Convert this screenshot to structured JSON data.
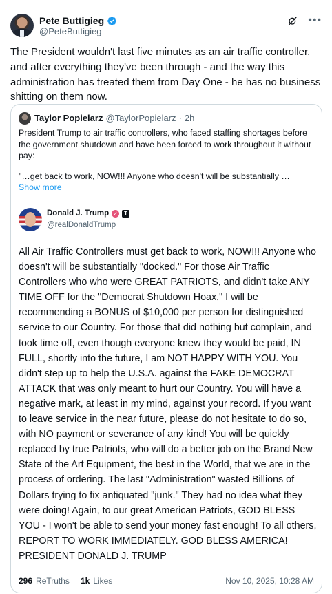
{
  "author": {
    "name": "Pete Buttigieg",
    "handle": "@PeteButtigieg"
  },
  "tweet_text": "The President wouldn't last five minutes as an air traffic controller, and after everything they've been through - and the way this administration has treated them from Day One - he has no business shitting on them now.",
  "icons": {
    "verified": "verified-badge-icon",
    "grok": "grok-icon",
    "more": "more-icon"
  },
  "colors": {
    "link": "#1d9bf0",
    "verified_blue": "#1d9bf0",
    "secondary_text": "#536471",
    "border": "#cfd9de"
  },
  "quote": {
    "name": "Taylor Popielarz",
    "handle": "@TaylorPopielarz",
    "separator": "·",
    "time": "2h",
    "text_p1": "President Trump to air traffic controllers, who faced staffing shortages before the government shutdown and have been forced to work throughout it without pay:",
    "text_p2": "\"…get back to work, NOW!!! Anyone who doesn't will be substantially …",
    "show_more": "Show more",
    "embed": {
      "name": "Donald J. Trump",
      "handle": "@realDonaldTrump",
      "check_symbol": "✓",
      "logo_symbol": "T",
      "text": "All Air Traffic Controllers must get back to work, NOW!!! Anyone who doesn't will be substantially \"docked.\" For those Air Traffic Controllers who who were GREAT PATRIOTS, and didn't take ANY TIME OFF for the \"Democrat Shutdown Hoax,\" I will be recommending a BONUS of $10,000 per person for distinguished service to our Country. For those that did nothing but complain, and took time off, even though everyone knew they would be paid, IN FULL, shortly into the future, I am NOT HAPPY WITH YOU. You didn't step up to help the U.S.A. against the FAKE DEMOCRAT ATTACK that was only meant to hurt our Country. You will have a negative mark, at least in my mind, against your record. If you want to leave service in the near future, please do not hesitate to do so, with NO payment or severance of any kind! You will be quickly replaced by true Patriots, who will do a better job on the Brand New State of the Art Equipment, the best in the World, that we are in the process of ordering. The last \"Administration\" wasted Billions of Dollars trying to fix antiquated \"junk.\" They had no idea what they were doing! Again, to our great American Patriots, GOD BLESS YOU - I won't be able to send your money fast enough! To all others, REPORT TO WORK IMMEDIATELY. GOD BLESS AMERICA! PRESIDENT DONALD J. TRUMP",
      "retruths_count": "296",
      "retruths_label": "ReTruths",
      "likes_count": "1k",
      "likes_label": "Likes",
      "date": "Nov 10, 2025, 10:28 AM"
    }
  }
}
